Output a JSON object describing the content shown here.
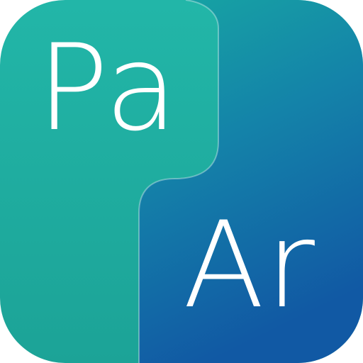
{
  "icon": {
    "top_text": "Pa",
    "bottom_text": "Ar",
    "colors": {
      "teal": "#22b3a6",
      "teal_dark": "#1ba598",
      "blue_top": "#1aa3a3",
      "blue_bottom": "#1264a8",
      "text": "#ffffff"
    }
  }
}
